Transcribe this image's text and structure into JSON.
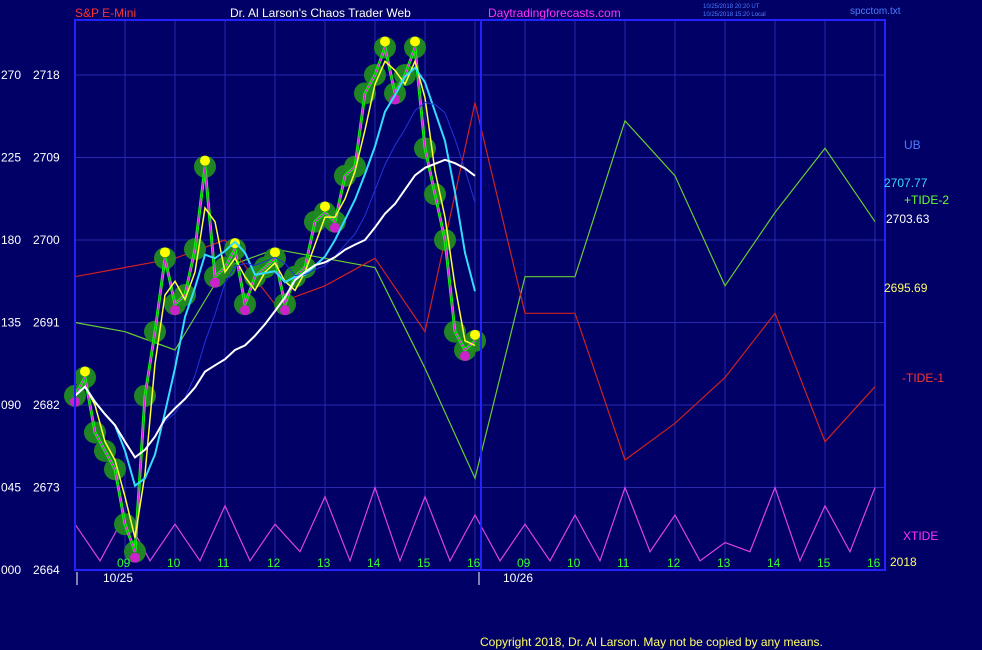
{
  "header": {
    "symbol": "S&P E-Mini",
    "title": "Dr. Al Larson's Chaos Trader Web",
    "site": "Daytradingforecasts.com",
    "timestamp_ut": "10/25/2018 20:20 UT",
    "timestamp_local": "10/25/2018 15:20 Local",
    "filename": "spcctom.txt"
  },
  "footer": {
    "copyright": "Copyright 2018, Dr. Al Larson. May not be copied by any means.",
    "year": "2018"
  },
  "colors": {
    "background": "#000066",
    "frame": "#2222ff",
    "grid": "#2a2ab0",
    "price_bars": "#00ff00",
    "clouds": "#228B22",
    "highs": "#ffff00",
    "lows": "#cc22cc",
    "yellow_avg": "#ffff33",
    "magenta_line": "#ff00ff",
    "cyan_avg": "#33ddff",
    "white_avg": "#ffffff",
    "blue_avg": "#2233dd",
    "tide_plus": "#66cc33",
    "tide_minus": "#cc2222",
    "xtide": "#dd44dd"
  },
  "chart_data": {
    "type": "line",
    "title": "S&P E-Mini",
    "y_axis": {
      "price_labels": [
        "2664",
        "2673",
        "2682",
        "2691",
        "2700",
        "2709",
        "2718"
      ],
      "aux_labels": [
        "000",
        "045",
        "090",
        "135",
        "180",
        "225",
        "270"
      ],
      "ylim": [
        2664,
        2724
      ]
    },
    "x_axis": {
      "hour_labels": [
        "09",
        "10",
        "11",
        "12",
        "13",
        "14",
        "15",
        "16",
        "09",
        "10",
        "11",
        "12",
        "13",
        "14",
        "15",
        "16"
      ],
      "date_labels": [
        "10/25",
        "10/26"
      ],
      "xlim": [
        0,
        16.2
      ]
    },
    "grid": true,
    "right_labels": {
      "ub": "UB",
      "tide_plus": "+TIDE-2",
      "tide_minus": "-TIDE-1",
      "xtide": "XTIDE",
      "price_cyan": "2707.77",
      "price_white": "2703.63",
      "price_yellow": "2695.69"
    },
    "series": [
      {
        "name": "S&P E-Mini",
        "x": [
          0,
          0.2,
          0.4,
          0.6,
          0.8,
          1.0,
          1.2,
          1.4,
          1.6,
          1.8,
          2.0,
          2.2,
          2.4,
          2.6,
          2.8,
          3.0,
          3.2,
          3.4,
          3.6,
          3.8,
          4.0,
          4.2,
          4.4,
          4.6,
          4.8,
          5.0,
          5.2,
          5.4,
          5.6,
          5.8,
          6.0,
          6.2,
          6.4,
          6.6,
          6.8,
          7.0,
          7.2,
          7.4,
          7.6,
          7.8,
          8.0
        ],
        "y": [
          2683,
          2685,
          2679,
          2677,
          2675,
          2669,
          2666,
          2683,
          2690,
          2698,
          2693,
          2694,
          2699,
          2708,
          2696,
          2697,
          2699,
          2693,
          2696,
          2697,
          2698,
          2693,
          2696,
          2697,
          2702,
          2703,
          2702,
          2707,
          2708,
          2716,
          2718,
          2721,
          2716,
          2718,
          2721,
          2710,
          2705,
          2700,
          2690,
          2688,
          2689
        ]
      },
      {
        "name": "+TIDE-2",
        "x": [
          0,
          1,
          2,
          3,
          4,
          5,
          6,
          7,
          8,
          9,
          10,
          11,
          12,
          13,
          14,
          15,
          16
        ],
        "y": [
          2691,
          2690,
          2688,
          2697,
          2699,
          2698,
          2697,
          2686,
          2674,
          2696,
          2696,
          2713,
          2707,
          2695,
          2703,
          2710,
          2702
        ]
      },
      {
        "name": "-TIDE-1",
        "x": [
          0,
          1,
          2,
          3,
          4,
          5,
          6,
          7,
          8,
          9,
          10,
          11,
          12,
          13,
          14,
          15,
          16
        ],
        "y": [
          2696,
          2697,
          2698,
          2700,
          2693,
          2695,
          2698,
          2690,
          2715,
          2692,
          2692,
          2676,
          2680,
          2685,
          2692,
          2678,
          2684
        ]
      },
      {
        "name": "XTIDE",
        "x": [
          0,
          0.5,
          1,
          1.5,
          2,
          2.5,
          3,
          3.5,
          4,
          4.5,
          5,
          5.5,
          6,
          6.5,
          7,
          7.5,
          8,
          8.5,
          9,
          9.5,
          10,
          10.5,
          11,
          11.5,
          12,
          12.5,
          13,
          13.5,
          14,
          14.5,
          15,
          15.5,
          16
        ],
        "y": [
          2669,
          2665,
          2670,
          2665,
          2669,
          2665,
          2671,
          2665,
          2669,
          2666,
          2672,
          2665,
          2673,
          2665,
          2672,
          2665,
          2670,
          2665,
          2669,
          2665,
          2670,
          2665,
          2673,
          2666,
          2670,
          2665,
          2667,
          2666,
          2673,
          2665,
          2671,
          2666,
          2673
        ]
      }
    ]
  }
}
